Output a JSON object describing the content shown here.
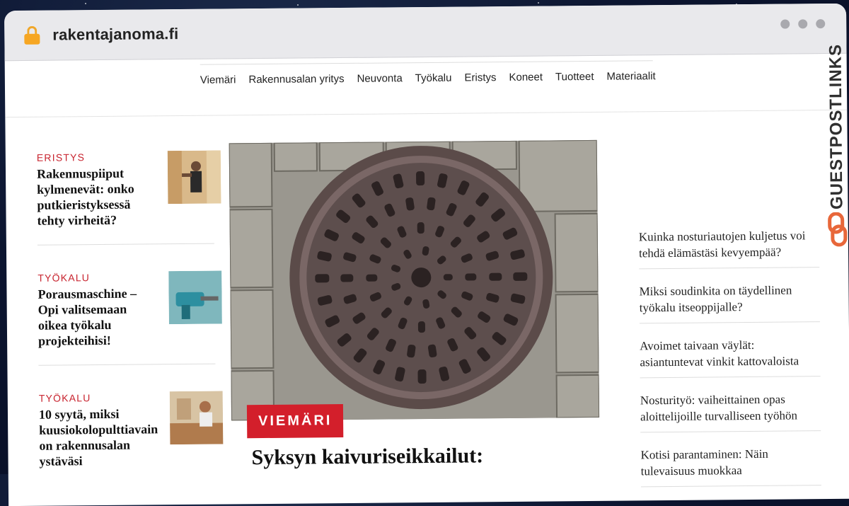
{
  "browser": {
    "url": "rakentajanoma.fi"
  },
  "nav": {
    "items": [
      "Viemäri",
      "Rakennusalan yritys",
      "Neuvonta",
      "Työkalu",
      "Eristys",
      "Koneet",
      "Tuotteet",
      "Materiaalit"
    ]
  },
  "left_articles": [
    {
      "category": "ERISTYS",
      "title": "Rakennuspiiput kylmenevät: onko putkieristyksessä tehty virheitä?",
      "image": "insulation-worker-photo"
    },
    {
      "category": "TYÖKALU",
      "title": "Porausmaschine – Opi valitsemaan oikea työkalu projekteihisi!",
      "image": "drill-photo"
    },
    {
      "category": "TYÖKALU",
      "title": "10 syytä, miksi kuusiokolopulttiavain on rakennusalan ystäväsi",
      "image": "workshop-photo"
    }
  ],
  "featured": {
    "category": "VIEMÄRI",
    "title": "Syksyn kaivuriseikkailut:",
    "image": "manhole-cover-photo"
  },
  "right_articles": [
    {
      "title": "Kuinka nosturiautojen kuljetus voi tehdä elämästäsi kevyempää?"
    },
    {
      "title": "Miksi soudinkita on täydellinen työkalu itseoppijalle?"
    },
    {
      "title": "Avoimet taivaan väylät: asiantuntevat vinkit kattovaloista"
    },
    {
      "title": "Nosturityö: vaiheittainen opas aloittelijoille turvalliseen työhön"
    },
    {
      "title": "Kotisi parantaminen: Näin tulevaisuus muokkaa"
    }
  ],
  "brand": {
    "text": "GUESTPOSTLINKS"
  },
  "colors": {
    "accent": "#d31f2b",
    "lock": "#f6a623",
    "brand_orange": "#e8673a"
  }
}
